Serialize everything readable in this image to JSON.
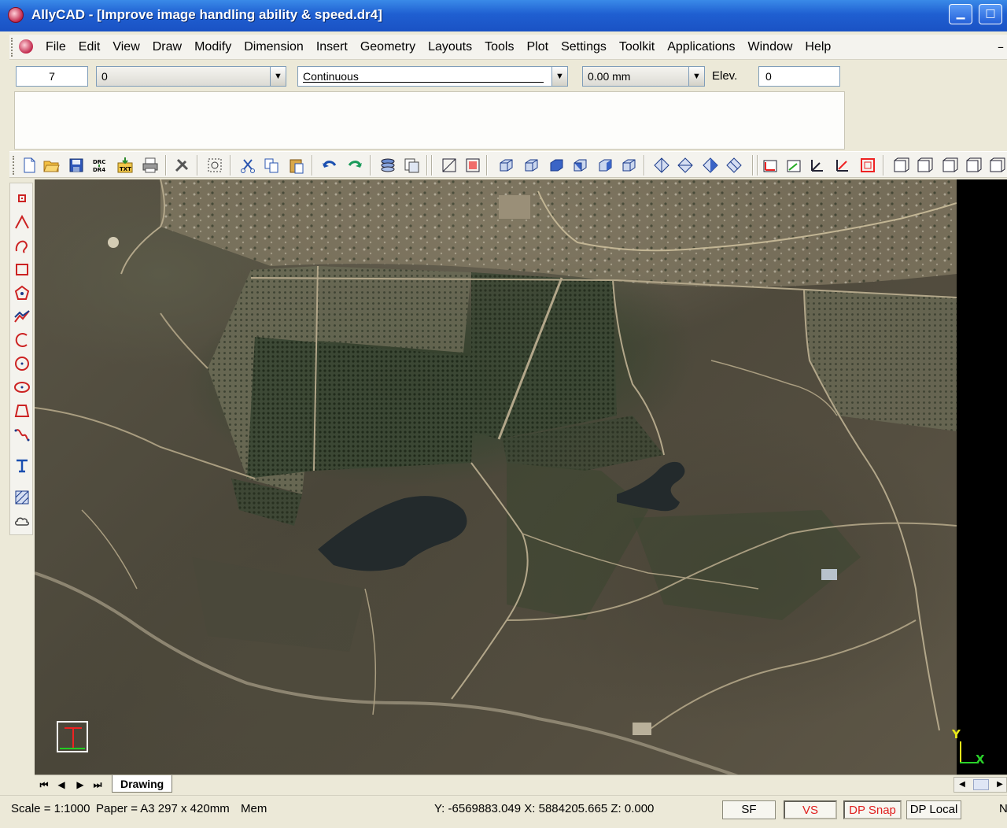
{
  "window": {
    "title": "AllyCAD - [Improve image handling ability & speed.dr4]",
    "minimize_glyph": "▁",
    "maximize_glyph": "□"
  },
  "menu": {
    "items": [
      "File",
      "Edit",
      "View",
      "Draw",
      "Modify",
      "Dimension",
      "Insert",
      "Geometry",
      "Layouts",
      "Tools",
      "Plot",
      "Settings",
      "Toolkit",
      "Applications",
      "Window",
      "Help"
    ],
    "right_glyph": "–"
  },
  "properties": {
    "color_value": "7",
    "layer_value": "0",
    "linetype_value": "Continuous",
    "lineweight_value": "0.00 mm",
    "elev_label": "Elev.",
    "elev_value": "0"
  },
  "tabs": {
    "nav_first": "⏮",
    "nav_prev": "◀",
    "nav_next": "▶",
    "nav_last": "⏭",
    "active": "Drawing"
  },
  "status": {
    "scale": "Scale = 1:1000",
    "paper": "Paper = A3 297 x 420mm",
    "mem": "Mem",
    "coords": "Y: -6569883.049 X: 5884205.665 Z: 0.000",
    "sf": "SF",
    "vs": "VS",
    "dp_snap": "DP Snap",
    "dp_local": "DP Local",
    "trail": "N"
  },
  "axes": {
    "y": "Y",
    "x": "X"
  },
  "colors": {
    "title_bar": "#1f5fd1",
    "status_red": "#e0201f",
    "canvas_black": "#000000"
  },
  "toolbar_icons": [
    "new-file-icon",
    "open-folder-icon",
    "save-icon",
    "drc-export-icon",
    "txt-import-icon",
    "print-icon",
    "tools-icon",
    "zoom-select-icon",
    "cut-icon",
    "copy-icon",
    "paste-icon",
    "undo-icon",
    "redo-icon",
    "layers-icon",
    "properties-icon"
  ],
  "left_tool_icons": [
    "point-icon",
    "line-icon",
    "arc-icon",
    "rectangle-icon",
    "polygon-icon",
    "polyline-icon",
    "arc-3pt-icon",
    "circle-icon",
    "ellipse-icon",
    "trapezoid-icon",
    "spline-icon",
    "text-icon",
    "hatch-icon",
    "cloud-icon"
  ]
}
